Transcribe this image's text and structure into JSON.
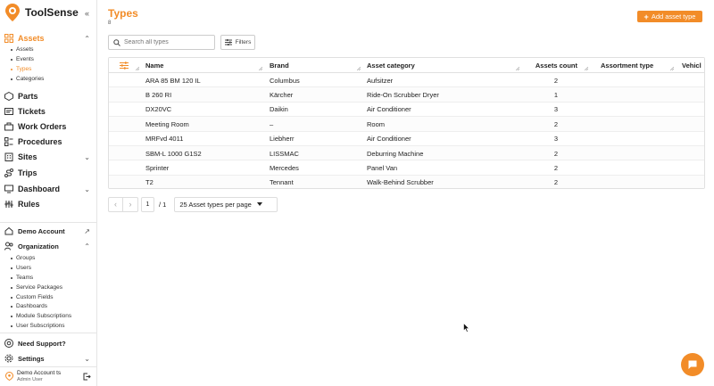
{
  "app": {
    "name": "ToolSense",
    "brand_color": "#f28c28"
  },
  "sidebar": {
    "assets": {
      "label": "Assets",
      "subitems": [
        "Assets",
        "Events",
        "Types",
        "Categories"
      ],
      "active_sub": "Types"
    },
    "items": [
      {
        "label": "Parts",
        "icon": "parts-icon"
      },
      {
        "label": "Tickets",
        "icon": "tickets-icon"
      },
      {
        "label": "Work Orders",
        "icon": "briefcase-icon"
      },
      {
        "label": "Procedures",
        "icon": "procedures-icon"
      },
      {
        "label": "Sites",
        "icon": "building-icon"
      },
      {
        "label": "Trips",
        "icon": "route-icon"
      },
      {
        "label": "Dashboard",
        "icon": "dashboard-icon"
      },
      {
        "label": "Rules",
        "icon": "rules-icon"
      }
    ],
    "demo_account": "Demo Account",
    "organization": {
      "label": "Organization",
      "subitems": [
        "Groups",
        "Users",
        "Teams",
        "Service Packages",
        "Custom Fields",
        "Dashboards",
        "Module Subscriptions",
        "User Subscriptions"
      ]
    },
    "support": "Need Support?",
    "settings": "Settings",
    "user": {
      "name": "Demo Account ts",
      "role": "Admin User"
    }
  },
  "page": {
    "title": "Types",
    "count": "8",
    "add_button": "Add asset type",
    "search_placeholder": "Search all types",
    "filters_label": "Filters"
  },
  "table": {
    "columns": [
      "Name",
      "Brand",
      "Asset category",
      "Assets count",
      "Assortment type",
      "Vehicl"
    ],
    "rows": [
      {
        "name": "ARA 85 BM 120 IL",
        "brand": "Columbus",
        "category": "Aufsitzer",
        "count": "2"
      },
      {
        "name": "B 260 RI",
        "brand": "Kärcher",
        "category": "Ride-On Scrubber Dryer",
        "count": "1"
      },
      {
        "name": "DX20VC",
        "brand": "Daikin",
        "category": "Air Conditioner",
        "count": "3"
      },
      {
        "name": "Meeting Room",
        "brand": "–",
        "category": "Room",
        "count": "2"
      },
      {
        "name": "MRFvd 4011",
        "brand": "Liebherr",
        "category": "Air Conditioner",
        "count": "3"
      },
      {
        "name": "SBM-L 1000 G1S2",
        "brand": "LISSMAC",
        "category": "Deburring Machine",
        "count": "2"
      },
      {
        "name": "Sprinter",
        "brand": "Mercedes",
        "category": "Panel Van",
        "count": "2"
      },
      {
        "name": "T2",
        "brand": "Tennant",
        "category": "Walk-Behind Scrubber",
        "count": "2"
      }
    ]
  },
  "pagination": {
    "current": "1",
    "total": "/ 1",
    "per_page": "25 Asset types per page"
  }
}
